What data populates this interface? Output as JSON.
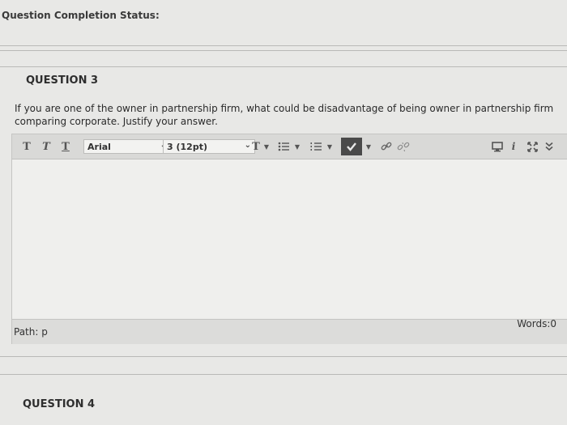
{
  "header": {
    "status_label": "Question Completion Status:"
  },
  "question3": {
    "title": "QUESTION 3",
    "text": "If you are one of the owner in partnership firm, what could be disadvantage of being owner in partnership firm comparing corporate. Justify your answer."
  },
  "editor": {
    "toolbar": {
      "bold": "T",
      "italic": "T",
      "underline": "T",
      "font_family": "Arial",
      "font_size": "3 (12pt)",
      "text_color": "T"
    },
    "footer": {
      "path": "Path: p",
      "words": "Words:0"
    }
  },
  "question4": {
    "title": "QUESTION 4"
  }
}
